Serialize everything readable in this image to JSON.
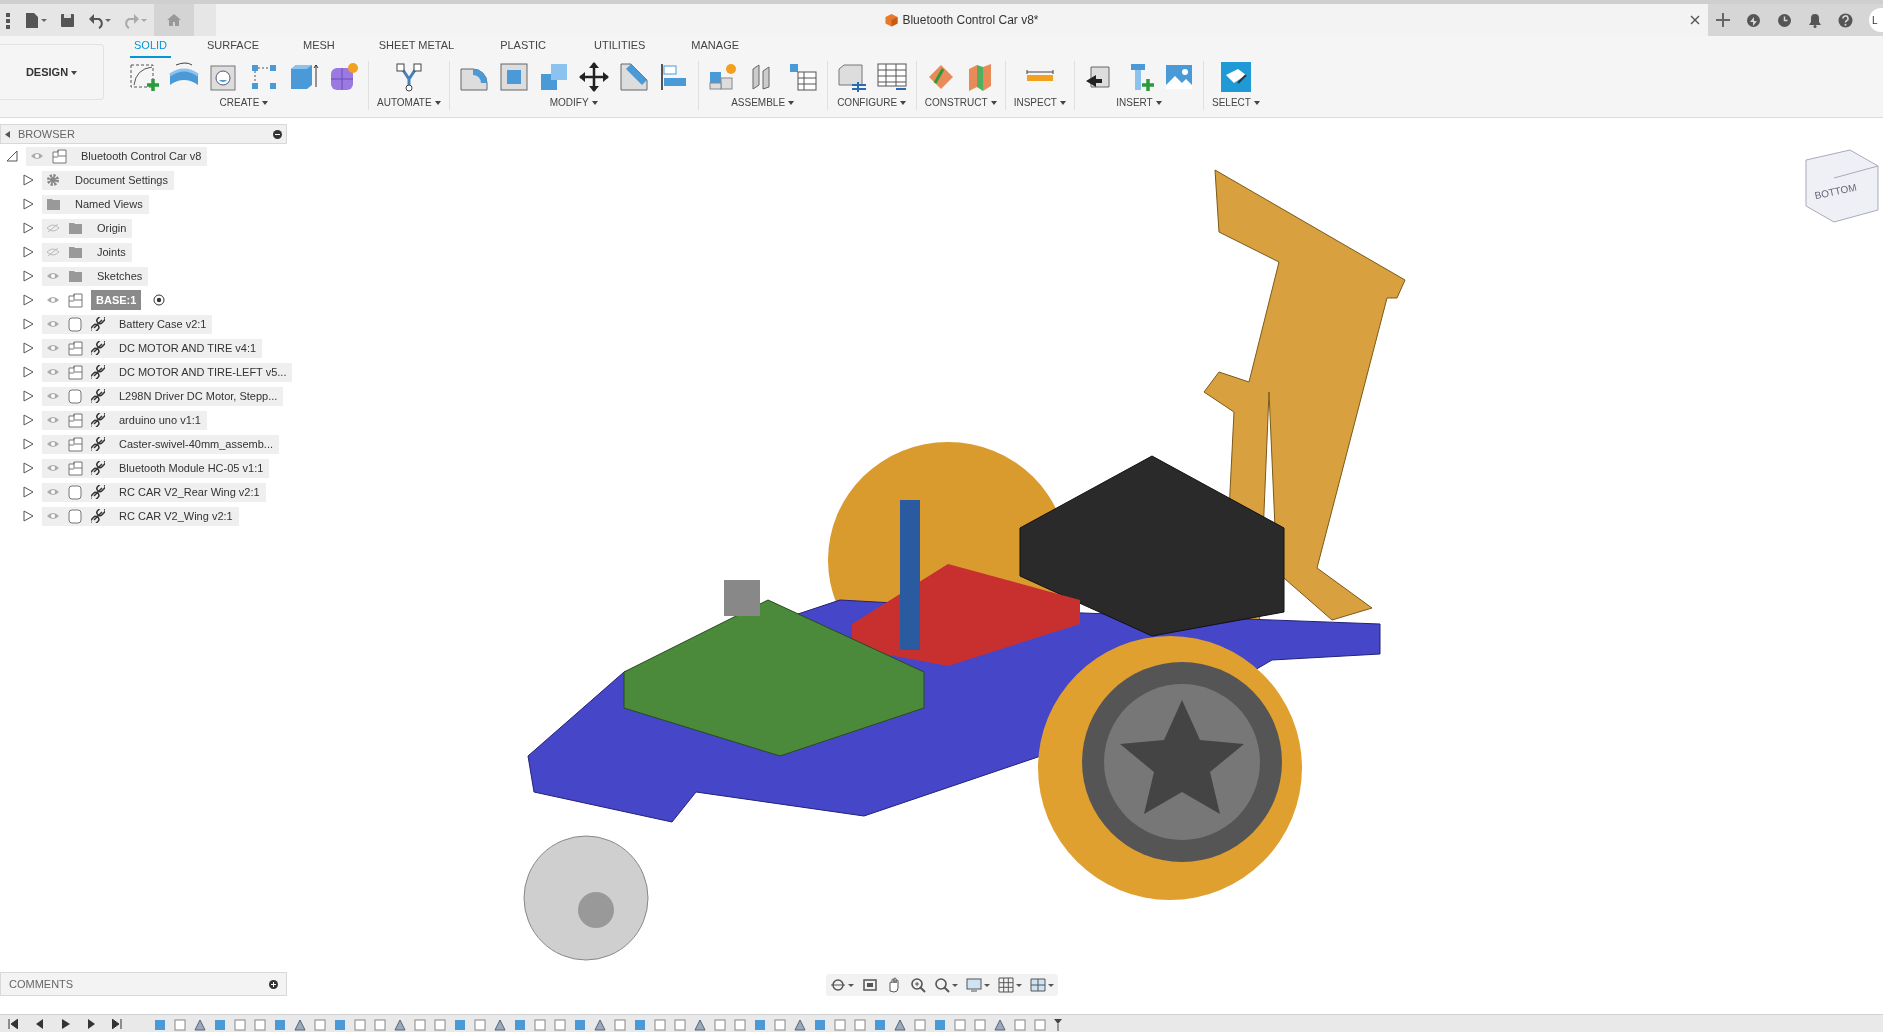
{
  "document_tab": {
    "title": "Bluetooth Control Car v8*"
  },
  "user": {
    "initials": "L"
  },
  "workspace": {
    "label": "DESIGN"
  },
  "toolbar_tabs": [
    {
      "label": "SOLID",
      "selected": true
    },
    {
      "label": "SURFACE",
      "selected": false
    },
    {
      "label": "MESH",
      "selected": false
    },
    {
      "label": "SHEET METAL",
      "selected": false
    },
    {
      "label": "PLASTIC",
      "selected": false
    },
    {
      "label": "UTILITIES",
      "selected": false
    },
    {
      "label": "MANAGE",
      "selected": false
    }
  ],
  "tool_groups": [
    {
      "label": "CREATE"
    },
    {
      "label": "AUTOMATE"
    },
    {
      "label": "MODIFY"
    },
    {
      "label": "ASSEMBLE"
    },
    {
      "label": "CONFIGURE"
    },
    {
      "label": "CONSTRUCT"
    },
    {
      "label": "INSPECT"
    },
    {
      "label": "INSERT"
    },
    {
      "label": "SELECT"
    }
  ],
  "browser": {
    "title": "BROWSER",
    "root": {
      "label": "Bluetooth Control Car v8",
      "kind": "component",
      "expanded": true,
      "visible": true,
      "linked": false,
      "selected": false,
      "children": [
        {
          "label": "Document Settings",
          "kind": "settings",
          "expanded": false,
          "linked": false,
          "selected": false
        },
        {
          "label": "Named Views",
          "kind": "folder",
          "expanded": false,
          "linked": false,
          "selected": false
        },
        {
          "label": "Origin",
          "kind": "folder",
          "expanded": false,
          "visible": false,
          "linked": false,
          "selected": false
        },
        {
          "label": "Joints",
          "kind": "folder",
          "expanded": false,
          "visible": false,
          "linked": false,
          "selected": false
        },
        {
          "label": "Sketches",
          "kind": "folder",
          "expanded": false,
          "visible": true,
          "linked": false,
          "selected": false
        },
        {
          "label": "BASE:1",
          "kind": "component",
          "expanded": false,
          "visible": true,
          "linked": false,
          "selected": true,
          "active": true
        },
        {
          "label": "Battery Case v2:1",
          "kind": "body",
          "expanded": false,
          "visible": true,
          "linked": true,
          "selected": false
        },
        {
          "label": "DC MOTOR AND TIRE v4:1",
          "kind": "component",
          "expanded": false,
          "visible": true,
          "linked": true,
          "selected": false
        },
        {
          "label": "DC MOTOR AND TIRE-LEFT v5...",
          "kind": "component",
          "expanded": false,
          "visible": true,
          "linked": true,
          "selected": false
        },
        {
          "label": "L298N Driver DC Motor, Stepp...",
          "kind": "body",
          "expanded": false,
          "visible": true,
          "linked": true,
          "selected": false
        },
        {
          "label": "arduino uno v1:1",
          "kind": "component",
          "expanded": false,
          "visible": true,
          "linked": true,
          "selected": false
        },
        {
          "label": "Caster-swivel-40mm_assemb...",
          "kind": "component",
          "expanded": false,
          "visible": true,
          "linked": true,
          "selected": false
        },
        {
          "label": "Bluetooth Module HC-05 v1:1",
          "kind": "component",
          "expanded": false,
          "visible": true,
          "linked": true,
          "selected": false
        },
        {
          "label": "RC CAR V2_Rear Wing v2:1",
          "kind": "body",
          "expanded": false,
          "visible": true,
          "linked": true,
          "selected": false
        },
        {
          "label": "RC CAR V2_Wing v2:1",
          "kind": "body",
          "expanded": false,
          "visible": true,
          "linked": true,
          "selected": false
        }
      ]
    }
  },
  "view_cube": {
    "face": "BOTTOM"
  },
  "comments": {
    "title": "COMMENTS"
  }
}
